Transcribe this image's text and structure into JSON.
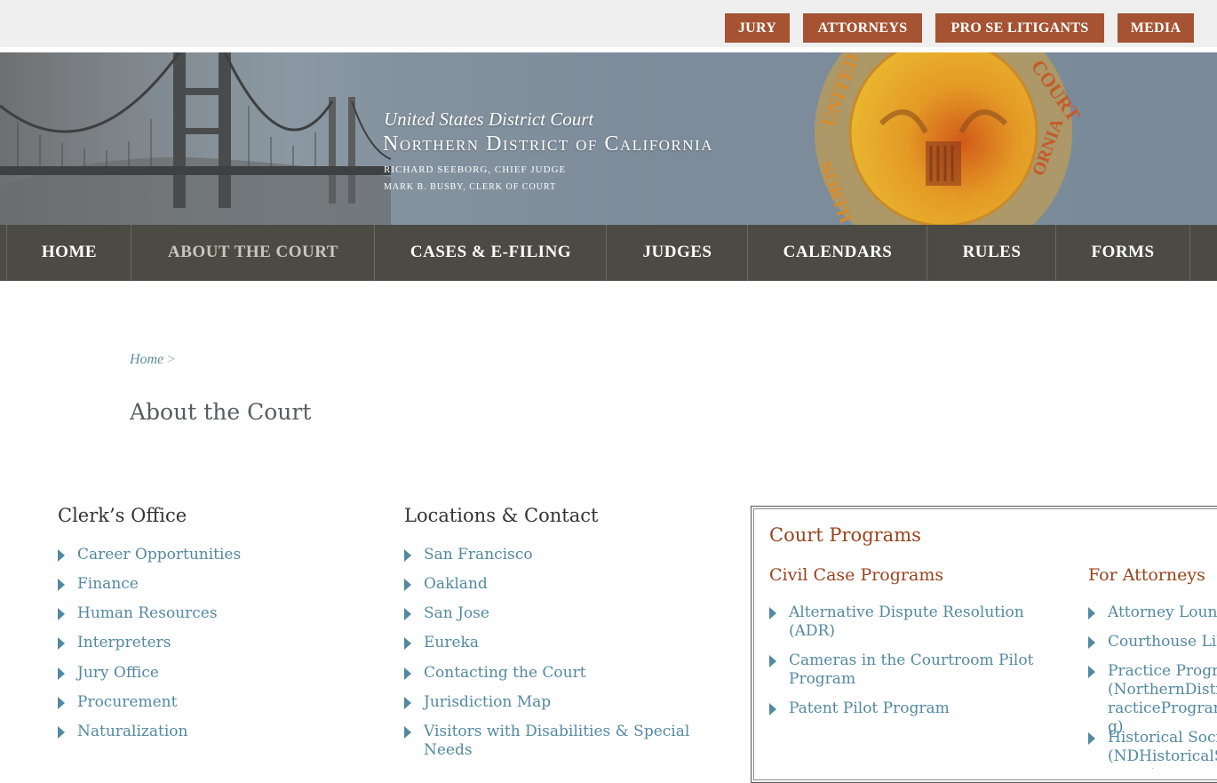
{
  "top_nav": {
    "jury": "JURY",
    "attorneys": "ATTORNEYS",
    "pro_se": "PRO SE LITIGANTS",
    "media": "MEDIA"
  },
  "banner": {
    "court": "United States District Court",
    "district": "Northern District of California",
    "chief_judge": "Richard Seeborg, Chief Judge",
    "clerk": "Mark B. Busby, Clerk of Court"
  },
  "main_nav": {
    "home": "HOME",
    "about": "ABOUT THE COURT",
    "cases": "CASES & E-FILING",
    "judges": "JUDGES",
    "calendars": "CALENDARS",
    "rules": "RULES",
    "forms": "FORMS"
  },
  "breadcrumb": {
    "home": "Home",
    "sep": ">"
  },
  "page_title": "About the Court",
  "clerks_office": {
    "heading": "Clerk’s Office",
    "links": [
      "Career Opportunities",
      "Finance",
      "Human Resources",
      "Interpreters",
      "Jury Office",
      "Procurement",
      "Naturalization"
    ]
  },
  "locations": {
    "heading": "Locations & Contact",
    "links": [
      "San Francisco",
      "Oakland",
      "San Jose",
      "Eureka",
      "Contacting the Court",
      "Jurisdiction Map",
      "Visitors with Disabilities & Special Needs"
    ]
  },
  "court_programs": {
    "heading": "Court Programs",
    "civil": {
      "heading": "Civil Case Programs",
      "links": [
        "Alternative Dispute Resolution (ADR)",
        "Cameras in the Courtroom Pilot Program",
        "Patent Pilot Program"
      ]
    },
    "attorneys": {
      "heading": "For Attorneys",
      "links": [
        "Attorney Lounge",
        "Courthouse Library",
        "Practice Program (NorthernDistrictPracticeProgram.org)",
        "Historical Society (NDHistoricalSociety.org)"
      ]
    }
  },
  "colors": {
    "accent": "#a55332",
    "nav_bg": "#4b4a43",
    "link": "#5289a2",
    "program_heading": "#99431c"
  }
}
